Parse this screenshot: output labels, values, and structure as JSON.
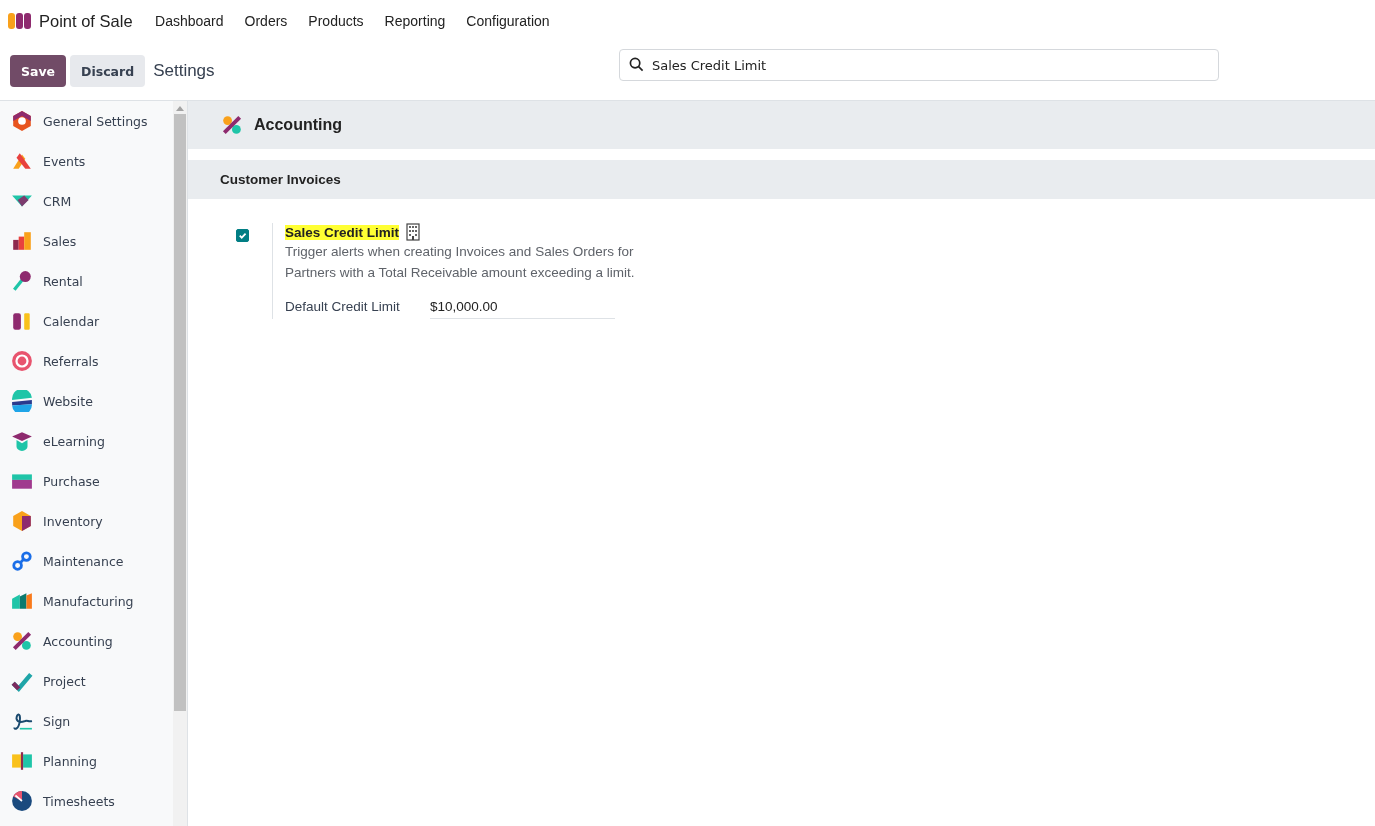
{
  "navbar": {
    "app_name": "Point of Sale",
    "menu": [
      "Dashboard",
      "Orders",
      "Products",
      "Reporting",
      "Configuration"
    ]
  },
  "control_panel": {
    "buttons": [
      "Save",
      "Discard"
    ],
    "title": "Settings",
    "search": {
      "value": "Sales Credit Limit"
    }
  },
  "sidebar": {
    "items": [
      {
        "label": "General Settings",
        "selected": false
      },
      {
        "label": "Events",
        "selected": false
      },
      {
        "label": "CRM",
        "selected": false
      },
      {
        "label": "Sales",
        "selected": false
      },
      {
        "label": "Rental",
        "selected": false
      },
      {
        "label": "Calendar",
        "selected": false
      },
      {
        "label": "Referrals",
        "selected": false
      },
      {
        "label": "Website",
        "selected": false
      },
      {
        "label": "eLearning",
        "selected": false
      },
      {
        "label": "Purchase",
        "selected": false
      },
      {
        "label": "Inventory",
        "selected": false
      },
      {
        "label": "Maintenance",
        "selected": false
      },
      {
        "label": "Manufacturing",
        "selected": false
      },
      {
        "label": "Accounting",
        "selected": false
      },
      {
        "label": "Project",
        "selected": false
      },
      {
        "label": "Sign",
        "selected": false
      },
      {
        "label": "Planning",
        "selected": false
      },
      {
        "label": "Timesheets",
        "selected": false
      }
    ]
  },
  "app_section": {
    "title": "Accounting",
    "block_title": "Customer Invoices",
    "setting": {
      "title": "Sales Credit Limit",
      "highlighted": true,
      "checked": true,
      "description": "Trigger alerts when creating Invoices and Sales Orders for Partners with a Total Receivable amount exceeding a limit.",
      "field_label": "Default Credit Limit",
      "field_value": "$10,000.00"
    }
  }
}
